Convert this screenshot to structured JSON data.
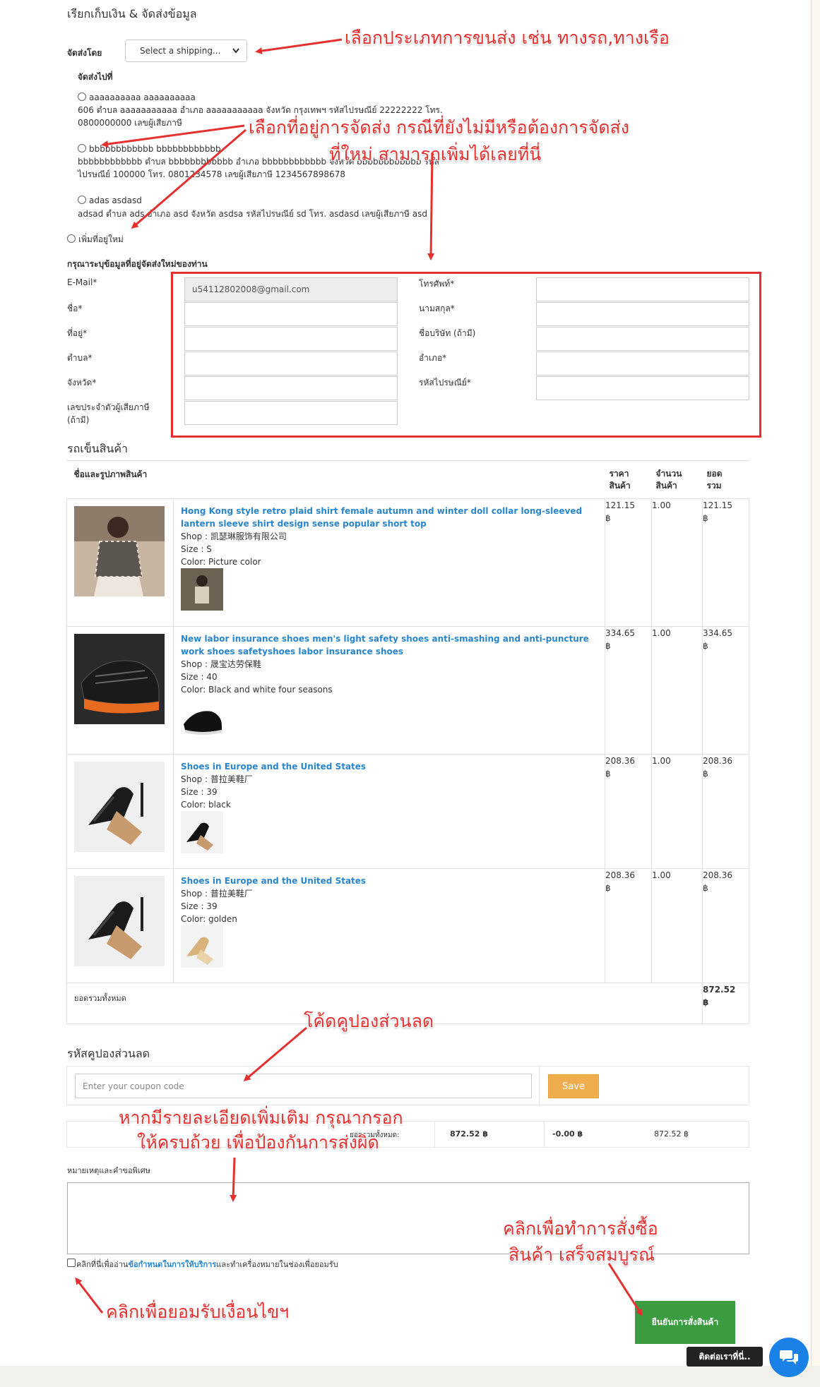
{
  "billing_title": "เรียกเก็บเงิน & จัดส่งข้อมูล",
  "shipping": {
    "label": "จัดส่งโดย",
    "selected": "Select a shipping..."
  },
  "ship_to_label": "จัดส่งไปที่",
  "addresses": [
    {
      "name": "aaaaaaaaaa aaaaaaaaaa",
      "detail": "606 ตำบล aaaaaaaaaaa อำเภอ aaaaaaaaaaa จังหวัด กรุงเทพฯ รหัสไปรษณีย์ 22222222 โทร.\n0800000000 เลขผู้เสียภาษี"
    },
    {
      "name": "bbbbbbbbbbbb bbbbbbbbbbbb",
      "detail": "bbbbbbbbbbbb ตำบล bbbbbbbbbbbb อำเภอ bbbbbbbbbbbb จังหวัด bbbbbbbbbbbb รหัส\nไปรษณีย์ 100000 โทร. 0801234578 เลขผู้เสียภาษี 1234567898678"
    },
    {
      "name": "adas asdasd",
      "detail": "adsad ตำบล ads อำเภอ asd จังหวัด asdsa รหัสไปรษณีย์ sd โทร. asdasd เลขผู้เสียภาษี asd"
    }
  ],
  "add_new_address": "เพิ่มที่อยู่ใหม่",
  "new_address_heading": "กรุณาระบุข้อมูลที่อยู่จัดส่งใหม่ของท่าน",
  "form": {
    "email_label": "E-Mail*",
    "email_value": "u54112802008@gmail.com",
    "name_label": "ชื่อ*",
    "address_label": "ที่อยู่*",
    "subdistrict_label": "ตำบล*",
    "province_label": "จังหวัด*",
    "taxid_label_1": "เลขประจำตัวผู้เสียภาษี",
    "taxid_label_2": "(ถ้ามี)",
    "phone_label": "โทรศัพท์*",
    "lastname_label": "นามสกุล*",
    "company_label": "ชื่อบริษัท (ถ้ามี)",
    "district_label": "อำเภอ*",
    "postcode_label": "รหัสไปรษณีย์*"
  },
  "cart": {
    "title": "รถเข็นสินค้า",
    "headers": {
      "product": "ชื่อและรูปภาพสินค้า",
      "price_1": "ราคา",
      "price_2": "สินค้า",
      "qty_1": "จำนวน",
      "qty_2": "สินค้า",
      "total_1": "ยอด",
      "total_2": "รวม"
    },
    "items": [
      {
        "title": "Hong Kong style retro plaid shirt female autumn and winter doll collar long-sleeved lantern sleeve shirt design sense popular short top",
        "shop": "Shop : 凯瑟琳服饰有限公司",
        "size": "Size : S",
        "color": "Color: Picture color",
        "price": "121.15",
        "qty": "1.00",
        "total": "121.15",
        "currency": "฿"
      },
      {
        "title": "New labor insurance shoes men's light safety shoes anti-smashing and anti-puncture work shoes safetyshoes labor insurance shoes",
        "shop": "Shop : 晟宝达劳保鞋",
        "size": "Size : 40",
        "color": "Color: Black and white four seasons",
        "price": "334.65",
        "qty": "1.00",
        "total": "334.65",
        "currency": "฿"
      },
      {
        "title": "Shoes in Europe and the United States",
        "shop": "Shop : 普拉美鞋厂",
        "size": "Size : 39",
        "color": "Color: black",
        "price": "208.36",
        "qty": "1.00",
        "total": "208.36",
        "currency": "฿"
      },
      {
        "title": "Shoes in Europe and the United States",
        "shop": "Shop : 普拉美鞋厂",
        "size": "Size : 39",
        "color": "Color: golden",
        "price": "208.36",
        "qty": "1.00",
        "total": "208.36",
        "currency": "฿"
      }
    ],
    "grand_total_label": "ยอดรวมทั้งหมด",
    "grand_total": "872.52",
    "currency": "฿"
  },
  "coupon": {
    "title": "รหัสคูปองส่วนลด",
    "placeholder": "Enter your coupon code",
    "save": "Save"
  },
  "summary": {
    "label": "ยอดรวมทั้งหมด:",
    "subtotal": "872.52 ฿",
    "discount": "-0.00 ฿",
    "total": "872.52 ฿"
  },
  "notes_label": "หมายเหตุและคำขอพิเศษ",
  "terms": {
    "prefix": "คลิกที่นี่เพื่ออ่าน",
    "link": "ข้อกำหนดในการให้บริการ",
    "suffix": "และทำเครื่องหมายในช่องเพื่อยอมรับ"
  },
  "confirm_button": "ยืนยันการสั่งสินค้า",
  "contact_button": "ติดต่อเราที่นี่..",
  "annotations": {
    "shipping_type": "เลือกประเภทการขนส่ง เช่น ทางรถ,ทางเรือ",
    "address_1": "เลือกที่อยู่การจัดส่ง กรณีที่ยังไม่มีหรือต้องการจัดส่ง",
    "address_2": "ที่ใหม่ สามารถเพิ่มได้เลยที่นี่",
    "coupon": "โค้ดคูปองส่วนลด",
    "details_1": "หากมีรายละเอียดเพิ่มเติม กรุณากรอก",
    "details_2": "ให้ครบถ้วย เพื่อป้องกันการส่งผิด",
    "confirm_1": "คลิกเพื่อทำการสั่งซื้อ",
    "confirm_2": "สินค้า เสร็จสมบูรณ์",
    "accept": "คลิกเพื่อยอมรับเงื่อนไขฯ"
  },
  "colors": {
    "annotation": "#e53030",
    "link": "#2a86cc",
    "confirm": "#3a9c3f",
    "save": "#f0ad4e",
    "chat": "#1a82e6"
  }
}
